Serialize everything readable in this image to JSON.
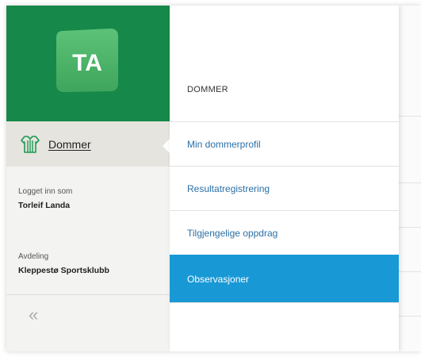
{
  "brand": {
    "logo_text": "TA",
    "color": "#16894a",
    "logo_color": "#4db86a"
  },
  "sidebar": {
    "current_section": {
      "icon": "jersey-icon",
      "label": "Dommer"
    },
    "user": {
      "caption": "Logget inn som",
      "name": "Torleif Landa"
    },
    "department": {
      "caption": "Avdeling",
      "name": "Kleppestø Sportsklubb"
    },
    "collapse_icon": "«"
  },
  "menu": {
    "header": "DOMMER",
    "items": [
      {
        "label": "Min dommerprofil",
        "active": false
      },
      {
        "label": "Resultatregistrering",
        "active": false
      },
      {
        "label": "Tilgjengelige oppdrag",
        "active": false
      },
      {
        "label": "Observasjoner",
        "active": true
      }
    ],
    "active_color": "#1899d6",
    "link_color": "#2a6fa6"
  }
}
